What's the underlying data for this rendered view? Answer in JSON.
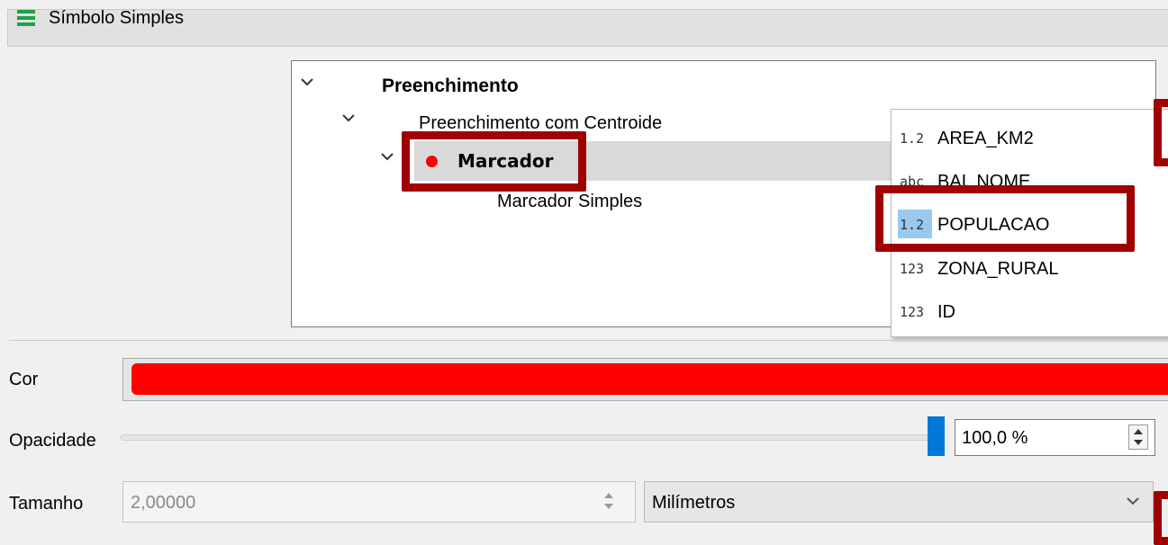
{
  "header": {
    "title": "Símbolo Simples",
    "icon": "symbol-layers-icon",
    "icon_color": "#1fa14a"
  },
  "tree": {
    "items": [
      {
        "label": "Preenchimento",
        "bold": true
      },
      {
        "label": "Preenchimento com Centroide",
        "bold": false
      },
      {
        "label": "Marcador",
        "bold": true,
        "selected": true,
        "marker_color": "#ff0000"
      },
      {
        "label": "Marcador Simples",
        "bold": false
      }
    ]
  },
  "field_popup": {
    "items": [
      {
        "type": "1.2",
        "name": "AREA_KM2"
      },
      {
        "type": "abc",
        "name": "BAI_NOME"
      },
      {
        "type": "1.2",
        "name": "POPULACAO",
        "highlighted": true
      },
      {
        "type": "123",
        "name": "ZONA_RURAL"
      },
      {
        "type": "123",
        "name": "ID"
      }
    ]
  },
  "form": {
    "cor": {
      "label": "Cor",
      "color": "#ff0000"
    },
    "opacidade": {
      "label": "Opacidade",
      "value": "100,0 %",
      "fraction": 1.0
    },
    "tamanho": {
      "label": "Tamanho",
      "value": "2,00000",
      "unit": "Milímetros"
    }
  },
  "annotation_color": "#a00000"
}
